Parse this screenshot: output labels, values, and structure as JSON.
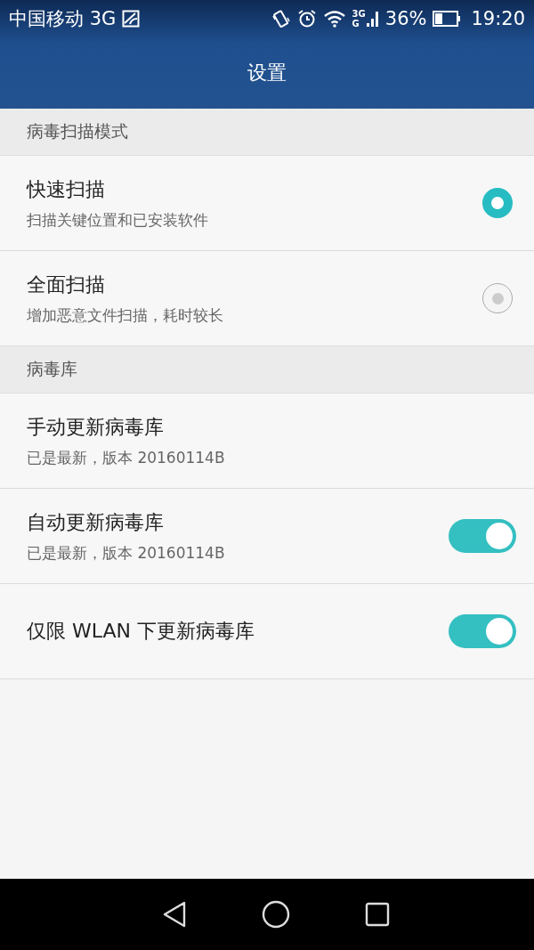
{
  "status_bar": {
    "carrier": "中国移动 3G",
    "network_top": "3G",
    "network_bottom": "G",
    "battery": "36%",
    "time": "19:20"
  },
  "header": {
    "title": "设置"
  },
  "sections": [
    {
      "title": "病毒扫描模式",
      "items": [
        {
          "kind": "radio",
          "title": "快速扫描",
          "subtitle": "扫描关键位置和已安装软件",
          "selected": true
        },
        {
          "kind": "radio",
          "title": "全面扫描",
          "subtitle": "增加恶意文件扫描，耗时较长",
          "selected": false
        }
      ]
    },
    {
      "title": "病毒库",
      "items": [
        {
          "kind": "plain",
          "title": "手动更新病毒库",
          "subtitle": "已是最新，版本 20160114B"
        },
        {
          "kind": "switch",
          "title": "自动更新病毒库",
          "subtitle": "已是最新，版本 20160114B",
          "on": true
        },
        {
          "kind": "switch",
          "title": "仅限 WLAN 下更新病毒库",
          "on": true
        }
      ]
    }
  ]
}
